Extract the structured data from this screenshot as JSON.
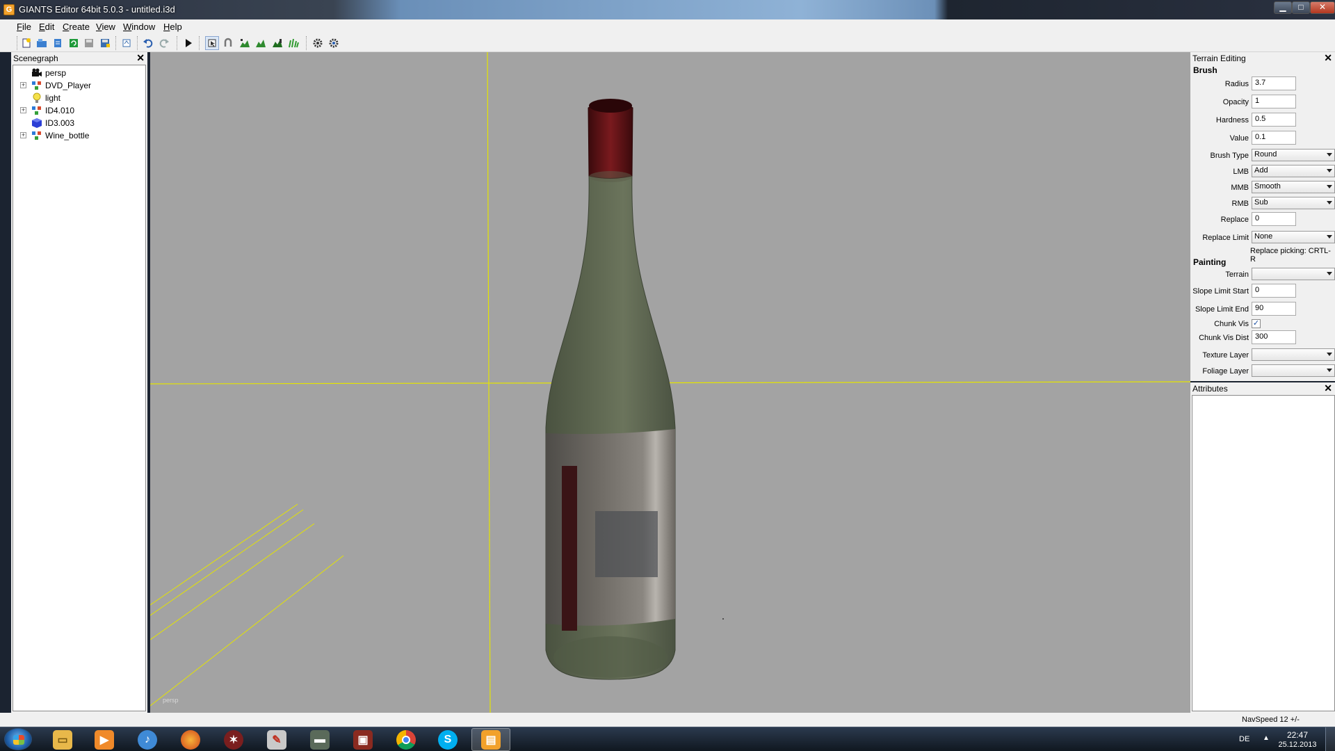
{
  "window": {
    "title": "GIANTS Editor 64bit 5.0.3 - untitled.i3d",
    "app_icon_text": "G",
    "minimize": "▁",
    "maximize": "□",
    "close": "✕"
  },
  "menu": [
    "File",
    "Edit",
    "Create",
    "View",
    "Window",
    "Help"
  ],
  "toolbar": {
    "buttons": [
      "new-icon",
      "open-icon",
      "open-list-icon",
      "reload-icon",
      "save-icon",
      "save-as-icon",
      "import-icon",
      "undo-icon",
      "redo-icon",
      "play-icon",
      "select-tool-icon",
      "move-tool-icon",
      "terrain-raise-icon",
      "terrain-paint-icon",
      "terrain-foliage-icon",
      "terrain-grass-icon",
      "settings-icon",
      "settings-alt-icon"
    ]
  },
  "scenegraph": {
    "title": "Scenegraph",
    "close": "✕",
    "items": [
      {
        "label": "persp",
        "icon": "camera-icon",
        "expandable": false
      },
      {
        "label": "DVD_Player",
        "icon": "transform-group-icon",
        "expandable": true
      },
      {
        "label": "light",
        "icon": "light-bulb-icon",
        "expandable": false
      },
      {
        "label": "ID4.010",
        "icon": "transform-group-icon",
        "expandable": true
      },
      {
        "label": "ID3.003",
        "icon": "shape-cube-icon",
        "expandable": false
      },
      {
        "label": "Wine_bottle",
        "icon": "transform-group-icon",
        "expandable": true
      }
    ]
  },
  "viewport": {
    "camera_label": "persp"
  },
  "terrain_editing": {
    "title": "Terrain Editing",
    "close": "✕",
    "brush_heading": "Brush",
    "radius_label": "Radius",
    "radius_value": "3.7",
    "opacity_label": "Opacity",
    "opacity_value": "1",
    "hardness_label": "Hardness",
    "hardness_value": "0.5",
    "value_label": "Value",
    "value_value": "0.1",
    "brush_type_label": "Brush Type",
    "brush_type_value": "Round",
    "lmb_label": "LMB",
    "lmb_value": "Add",
    "mmb_label": "MMB",
    "mmb_value": "Smooth",
    "rmb_label": "RMB",
    "rmb_value": "Sub",
    "replace_label": "Replace",
    "replace_value": "0",
    "replace_limit_label": "Replace Limit",
    "replace_limit_value": "None",
    "replace_hint": "Replace picking: CRTL-R",
    "painting_heading": "Painting",
    "terrain_label": "Terrain",
    "terrain_value": "",
    "slope_start_label": "Slope Limit Start",
    "slope_start_value": "0",
    "slope_end_label": "Slope Limit End",
    "slope_end_value": "90",
    "chunk_vis_label": "Chunk Vis",
    "chunk_vis_checked": "✓",
    "chunk_vis_dist_label": "Chunk Vis Dist",
    "chunk_vis_dist_value": "300",
    "texture_layer_label": "Texture Layer",
    "texture_layer_value": "",
    "foliage_layer_label": "Foliage Layer",
    "foliage_layer_value": ""
  },
  "attributes": {
    "title": "Attributes",
    "close": "✕"
  },
  "status": {
    "text": "NavSpeed 12 +/-"
  },
  "taskbar": {
    "apps": [
      "explorer-icon",
      "media-player-icon",
      "itunes-icon",
      "firefox-icon",
      "farming-sim-icon",
      "editor-icon",
      "tractor-icon",
      "game-icon",
      "chrome-icon",
      "skype-icon",
      "giants-editor-icon"
    ],
    "active_app": "giants-editor-icon",
    "language": "DE",
    "tray_arrow": "▲",
    "time": "22:47",
    "date": "25.12.2013"
  }
}
